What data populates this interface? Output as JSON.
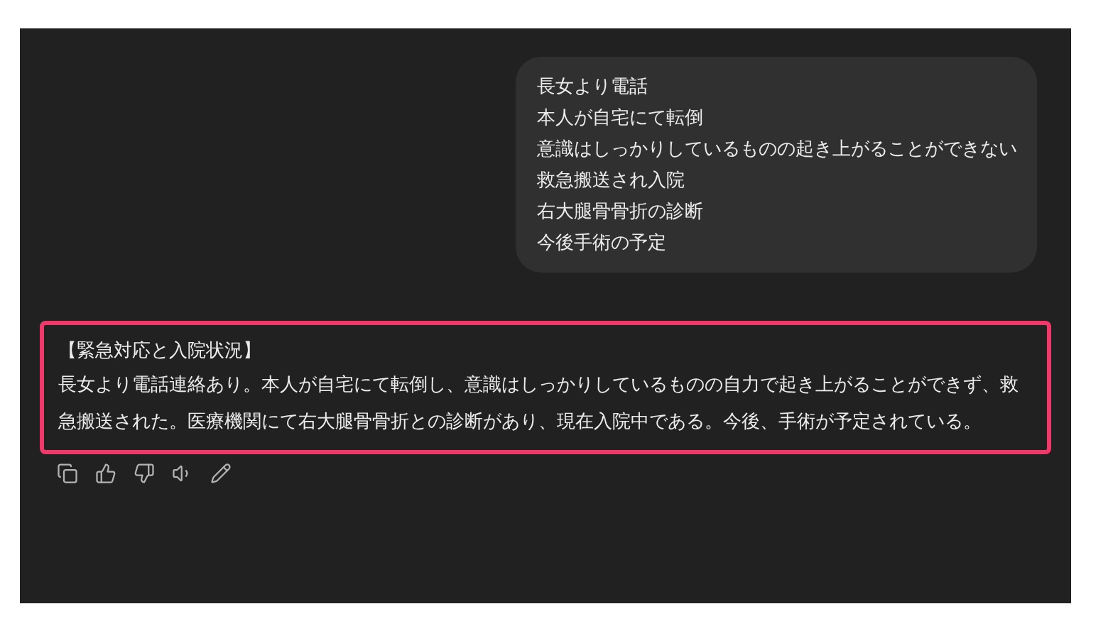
{
  "user_message": {
    "lines": [
      "長女より電話",
      "本人が自宅にて転倒",
      "意識はしっかりしているものの起き上がることができない",
      "救急搬送され入院",
      "右大腿骨骨折の診断",
      "今後手術の予定"
    ]
  },
  "response": {
    "heading": "【緊急対応と入院状況】",
    "body": "長女より電話連絡あり。本人が自宅にて転倒し、意識はしっかりしているものの自力で起き上がることができず、救急搬送された。医療機関にて右大腿骨骨折との診断があり、現在入院中である。今後、手術が予定されている。",
    "highlighted": true
  },
  "actions": [
    {
      "kind": "copy"
    },
    {
      "kind": "like"
    },
    {
      "kind": "dislike"
    },
    {
      "kind": "speak"
    },
    {
      "kind": "edit"
    }
  ]
}
